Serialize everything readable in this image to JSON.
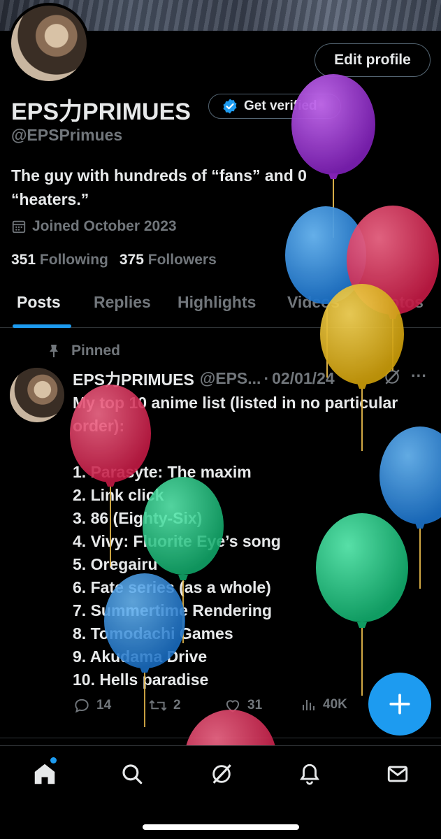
{
  "profile": {
    "edit_button": "Edit profile",
    "display_name": "EPS力PRIMUES",
    "verify_button": "Get verified",
    "handle": "@EPSPrimues",
    "bio": "The guy with hundreds of “fans” and 0 “heaters.”",
    "joined": "Joined October 2023",
    "following_count": "351",
    "following_label": "Following",
    "followers_count": "375",
    "followers_label": "Followers"
  },
  "tabs": [
    {
      "label": "Posts",
      "active": true
    },
    {
      "label": "Replies"
    },
    {
      "label": "Highlights"
    },
    {
      "label": "Videos"
    },
    {
      "label": "Photos"
    }
  ],
  "post": {
    "pinned_label": "Pinned",
    "author_name": "EPS力PRIMUES",
    "author_handle_truncated": "@EPS...",
    "separator": "·",
    "date": "02/01/24",
    "more": "···",
    "text": "My top 10 anime list (listed in no particular order):\n\n1. Parasyte: The maxim\n2. Link click\n3. 86 (Eighty-Six)\n4. Vivy: Fluorite Eye’s song\n5. Oregairu\n6. Fate series (as a whole)\n7. Summertime Rendering\n8. Tomodachi Games\n9. Akudama Drive\n10. Hells paradise",
    "replies": "14",
    "reposts": "2",
    "likes": "31",
    "views": "40K"
  },
  "nav": {
    "items": [
      "home-icon",
      "search-icon",
      "grok-icon",
      "notifications-icon",
      "messages-icon"
    ]
  },
  "colors": {
    "accent": "#1d9bf0",
    "muted": "#71767b",
    "text": "#e7e9ea",
    "border": "#2f3336",
    "balloon_purple": "#9b2fd1",
    "balloon_blue": "#2b8fe0",
    "balloon_red": "#e0335a",
    "balloon_yellow": "#e8b81c",
    "balloon_green": "#1fcf8a"
  }
}
